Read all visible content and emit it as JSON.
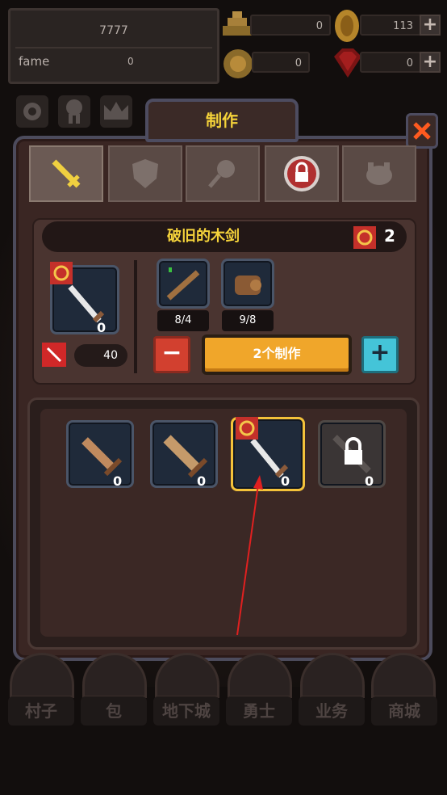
{
  "header": {
    "gold_value": "7777",
    "fame_label": "fame",
    "fame_value": "0",
    "gold_bars": "0",
    "coins": "113",
    "medals": "0",
    "gems": "0"
  },
  "panel": {
    "title": "制作",
    "tabs": [
      "sword-tab",
      "armor-tab",
      "accessory-tab",
      "locked-tab",
      "pet-tab"
    ],
    "item_name": "破旧的木剑",
    "owned_quantity": "2",
    "result_count": "0",
    "attack": "40",
    "materials": [
      {
        "icon": "stick-icon",
        "count": "8/4"
      },
      {
        "icon": "log-icon",
        "count": "9/8"
      }
    ],
    "minus_label": "−",
    "craft_label": "2个制作",
    "plus_label": "+"
  },
  "list": {
    "items": [
      {
        "icon": "wooden-sword-icon",
        "count": "0"
      },
      {
        "icon": "broad-sword-icon",
        "count": "0"
      },
      {
        "icon": "old-wooden-sword-icon",
        "count": "0",
        "selected": true
      },
      {
        "icon": "locked-item-icon",
        "count": "0",
        "locked": true
      }
    ]
  },
  "bottom_nav": [
    "村子",
    "包",
    "地下城",
    "勇士",
    "业务",
    "商城"
  ],
  "colors": {
    "accent": "#f5d33b",
    "craft": "#f0a62a",
    "minus": "#d2402f",
    "plus": "#44c4d8"
  }
}
